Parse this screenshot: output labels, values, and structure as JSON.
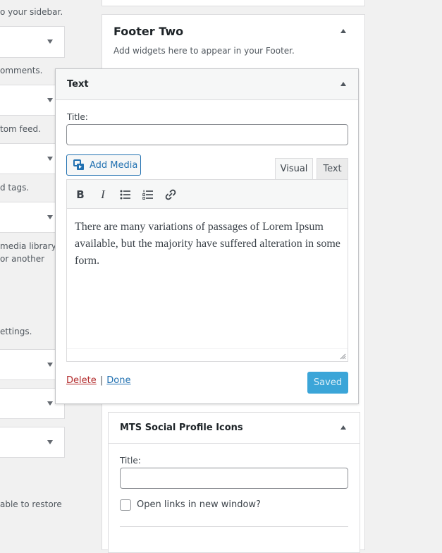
{
  "left_column": {
    "descriptions": [
      "o your sidebar.",
      "omments.",
      "tom feed.",
      "d tags.",
      "media library",
      "or another",
      "ettings.",
      "able to restore"
    ]
  },
  "footer_two": {
    "title": "Footer Two",
    "description": "Add widgets here to appear in your Footer."
  },
  "text_widget": {
    "header_title": "Text",
    "title_label": "Title:",
    "title_value": "",
    "add_media_label": "Add Media",
    "tabs": {
      "visual": "Visual",
      "text": "Text"
    },
    "toolbar": {
      "bold": "B",
      "italic": "I"
    },
    "content": "There are many variations of passages of Lorem Ipsum available, but the majority have suffered alteration in some form.",
    "delete_label": "Delete",
    "separator": "|",
    "done_label": "Done",
    "saved_label": "Saved"
  },
  "social_widget": {
    "header_title": "MTS Social Profile Icons",
    "title_label": "Title:",
    "title_value": "",
    "checkbox_label": "Open links in new window?",
    "checkbox_checked": false
  },
  "colors": {
    "link_blue": "#2271b1",
    "delete_red": "#b32d2e",
    "saved_button": "#1996d2"
  }
}
